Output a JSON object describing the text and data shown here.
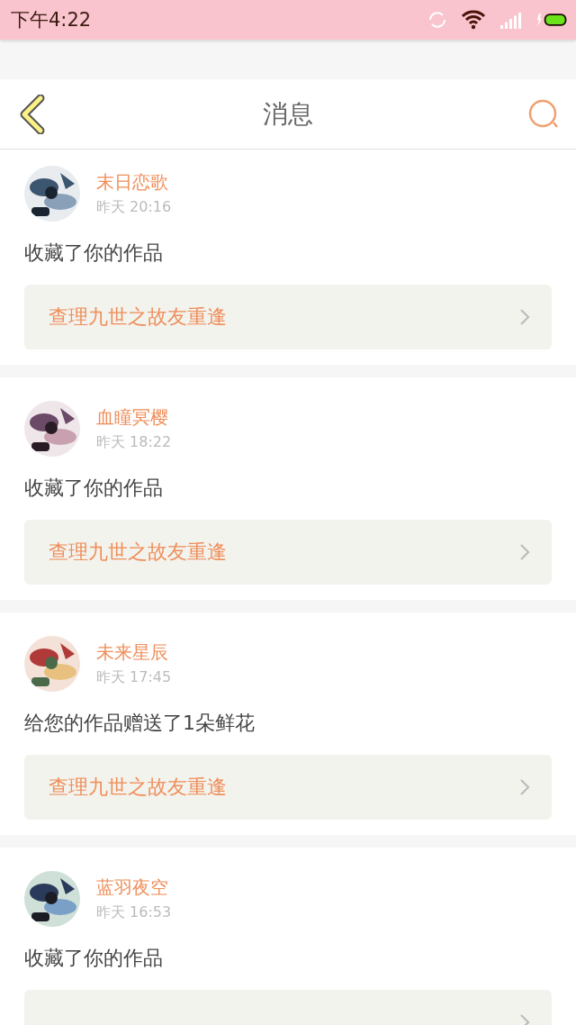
{
  "status_bar": {
    "time": "下午4:22"
  },
  "header": {
    "title": "消息"
  },
  "messages": [
    {
      "user": "末日恋歌",
      "time": "昨天 20:16",
      "action": "收藏了你的作品",
      "work": "查理九世之故友重逢"
    },
    {
      "user": "血瞳冥樱",
      "time": "昨天 18:22",
      "action": "收藏了你的作品",
      "work": "查理九世之故友重逢"
    },
    {
      "user": "未来星辰",
      "time": "昨天 17:45",
      "action": "给您的作品赠送了1朵鲜花",
      "work": "查理九世之故友重逢"
    },
    {
      "user": "蓝羽夜空",
      "time": "昨天 16:53",
      "action": "收藏了你的作品"
    }
  ]
}
